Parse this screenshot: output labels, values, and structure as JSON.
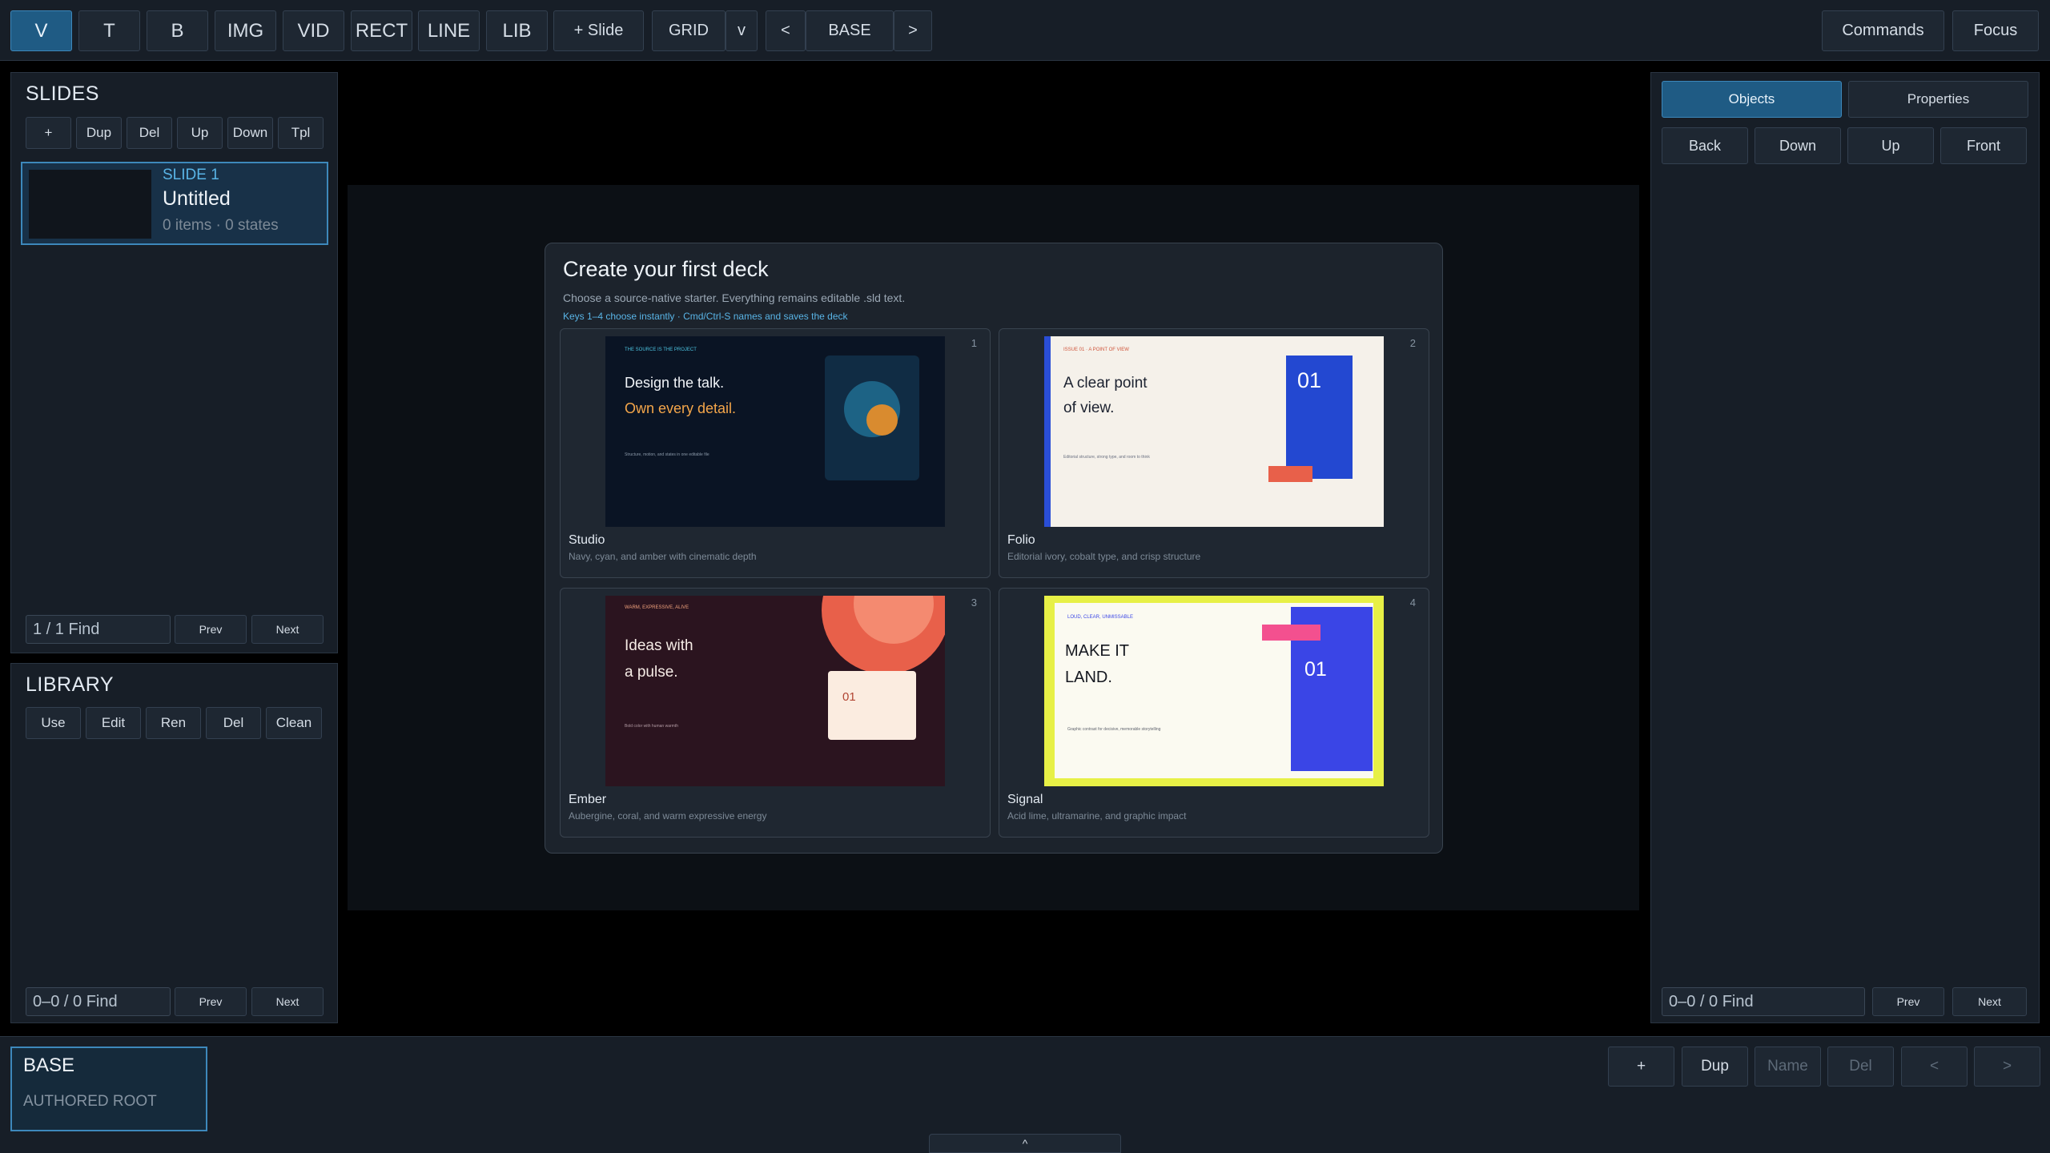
{
  "toolbar": {
    "tools": [
      "V",
      "T",
      "B",
      "IMG",
      "VID",
      "RECT",
      "LINE",
      "LIB"
    ],
    "add_slide": "+ Slide",
    "grid": "GRID",
    "grid_toggle": "v",
    "prev": "<",
    "state": "BASE",
    "next": ">",
    "commands": "Commands",
    "focus": "Focus"
  },
  "slides_panel": {
    "title": "SLIDES",
    "actions": [
      "+",
      "Dup",
      "Del",
      "Up",
      "Down",
      "Tpl"
    ],
    "items": [
      {
        "label": "SLIDE 1",
        "title": "Untitled",
        "meta": "0 items · 0 states"
      }
    ],
    "find": "1 / 1  Find",
    "prev": "Prev",
    "next": "Next"
  },
  "library_panel": {
    "title": "LIBRARY",
    "actions": [
      "Use",
      "Edit",
      "Ren",
      "Del",
      "Clean"
    ],
    "find": "0–0 / 0  Find",
    "prev": "Prev",
    "next": "Next"
  },
  "right_panel": {
    "tabs": [
      "Objects",
      "Properties"
    ],
    "order": [
      "Back",
      "Down",
      "Up",
      "Front"
    ],
    "find": "0–0 / 0  Find",
    "prev": "Prev",
    "next": "Next"
  },
  "dialog": {
    "title": "Create your first deck",
    "subtitle": "Choose a source-native starter. Everything remains editable .sld text.",
    "hint": "Keys 1–4 choose instantly · Cmd/Ctrl-S names and saves the deck",
    "templates": [
      {
        "num": "1",
        "name": "Studio",
        "desc": "Navy, cyan, and amber with cinematic depth",
        "kicker": "THE SOURCE IS THE PROJECT",
        "line1": "Design the talk.",
        "line2": "Own every detail.",
        "foot": "Structure, motion, and states in one editable file"
      },
      {
        "num": "2",
        "name": "Folio",
        "desc": "Editorial ivory, cobalt type, and crisp structure",
        "kicker": "ISSUE 01 · A POINT OF VIEW",
        "line1": "A clear point",
        "line2": "of view.",
        "foot": "Editorial structure, strong type, and room to think",
        "badge": "01"
      },
      {
        "num": "3",
        "name": "Ember",
        "desc": "Aubergine, coral, and warm expressive energy",
        "kicker": "WARM, EXPRESSIVE, ALIVE",
        "line1": "Ideas with",
        "line2": "a pulse.",
        "foot": "Bold color with human warmth",
        "badge": "01"
      },
      {
        "num": "4",
        "name": "Signal",
        "desc": "Acid lime, ultramarine, and graphic impact",
        "kicker": "LOUD, CLEAR, UNMISSABLE",
        "line1": "MAKE IT",
        "line2": "LAND.",
        "foot": "Graphic contrast for decisive, memorable storytelling",
        "badge": "01"
      }
    ]
  },
  "bottom": {
    "state_title": "BASE",
    "state_sub": "AUTHORED ROOT",
    "actions": [
      "+",
      "Dup",
      "Name",
      "Del",
      "<",
      ">"
    ],
    "collapse": "^"
  },
  "colors": {
    "accent": "#1f5b84",
    "accent_border": "#3d88bb",
    "panel": "#171e27",
    "studio_bg": "#0a1424",
    "folio_bg": "#f5f1ea",
    "ember_bg": "#2b141f",
    "signal_bg": "#e7f046"
  }
}
